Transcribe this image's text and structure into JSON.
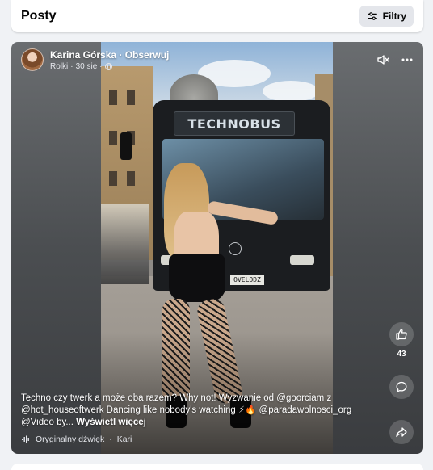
{
  "header": {
    "title": "Posty",
    "filter_label": "Filtry"
  },
  "post": {
    "author_name": "Karina Górska · Obserwuj",
    "meta_source": "Rolki",
    "meta_date": "30 sie",
    "meta_separator": "·",
    "video": {
      "bus_sign": "TECHNOBUS",
      "bus_plate": "OVELODZ"
    },
    "likes_count": "43",
    "caption": "Techno czy twerk a może oba razem? Why not! Wyzwanie od @goorciam z @hot_houseoftwerk Dancing like nobody's watching ⚡🔥 @paradawolnosci_org @Video by...",
    "see_more": "Wyświetl więcej",
    "audio_label": "Oryginalny dźwięk",
    "audio_author": "Kari"
  },
  "icons": {
    "filter": "sliders-icon",
    "mute": "speaker-muted-icon",
    "more": "more-dots-icon",
    "like": "thumbs-up-icon",
    "comment": "comment-bubble-icon",
    "share": "share-arrow-icon",
    "audio": "sound-wave-icon",
    "audience": "globe-icon"
  },
  "colors": {
    "page_bg": "#f0f2f5",
    "card_bg": "#ffffff",
    "filter_bg": "#e4e6eb",
    "text_primary": "#050505"
  }
}
